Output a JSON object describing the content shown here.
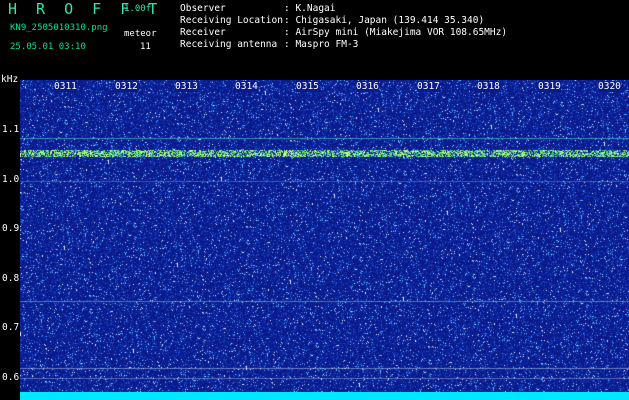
{
  "app": {
    "title": "H R O F F T",
    "version": "1.00f",
    "filename": "KN9_2505010310.png",
    "datetime": "25.05.01 03:10",
    "meteor_label": "meteor",
    "meteor_count": "11"
  },
  "info": [
    {
      "key": "Observer",
      "value": ": K.Nagai"
    },
    {
      "key": "Receiving Location",
      "value": ": Chigasaki, Japan (139.414 35.340)"
    },
    {
      "key": "Receiver",
      "value": ": AirSpy mini (Miakejima VOR 108.65MHz)"
    },
    {
      "key": "Receiving antenna",
      "value": ": Maspro FM-3"
    }
  ],
  "spectrogram": {
    "unit_label": "kHz",
    "y_ticks": [
      "1.1",
      "1.0",
      "0.9",
      "0.8",
      "0.7",
      "0.6"
    ],
    "time_labels": [
      "0311",
      "0312",
      "0313",
      "0314",
      "0315",
      "0316",
      "0317",
      "0318",
      "0319",
      "0320"
    ],
    "colors": {
      "background": "#0a1a8a",
      "signal": "#7cff3a",
      "baseline_bar": "#00e8ff"
    }
  }
}
